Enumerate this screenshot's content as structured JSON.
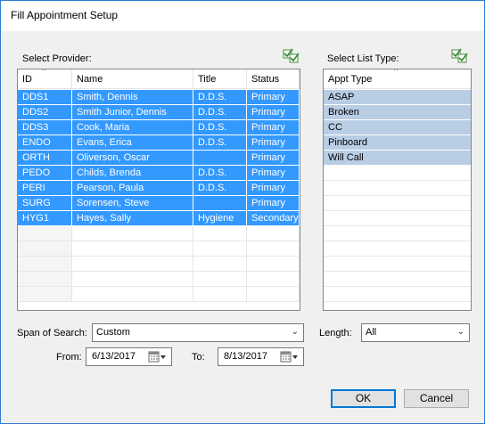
{
  "window": {
    "title": "Fill Appointment Setup"
  },
  "provider": {
    "label": "Select Provider:",
    "check_icon": "select-all-check-icon",
    "columns": [
      "ID",
      "Name",
      "Title",
      "Status"
    ],
    "sorted_column": "ID",
    "rows": [
      {
        "id": "DDS1",
        "name": "Smith, Dennis",
        "title": "D.D.S.",
        "status": "Primary",
        "selected": true
      },
      {
        "id": "DDS2",
        "name": "Smith Junior, Dennis",
        "title": "D.D.S.",
        "status": "Primary",
        "selected": true
      },
      {
        "id": "DDS3",
        "name": "Cook, Maria",
        "title": "D.D.S.",
        "status": "Primary",
        "selected": true
      },
      {
        "id": "ENDO",
        "name": "Evans, Erica",
        "title": "D.D.S.",
        "status": "Primary",
        "selected": true
      },
      {
        "id": "ORTH",
        "name": "Oliverson, Oscar",
        "title": "",
        "status": "Primary",
        "selected": true
      },
      {
        "id": "PEDO",
        "name": "Childs, Brenda",
        "title": "D.D.S.",
        "status": "Primary",
        "selected": true
      },
      {
        "id": "PERI",
        "name": "Pearson, Paula",
        "title": "D.D.S.",
        "status": "Primary",
        "selected": true
      },
      {
        "id": "SURG",
        "name": "Sorensen, Steve",
        "title": "",
        "status": "Primary",
        "selected": true
      },
      {
        "id": "HYG1",
        "name": "Hayes, Sally",
        "title": "Hygiene",
        "status": "Secondary",
        "selected": true
      }
    ]
  },
  "list_type": {
    "label": "Select List Type:",
    "check_icon": "select-all-check-icon",
    "columns": [
      "Appt Type"
    ],
    "rows": [
      "ASAP",
      "Broken",
      "CC",
      "Pinboard",
      "Will Call"
    ]
  },
  "search": {
    "span_label": "Span of Search:",
    "span_value": "Custom",
    "length_label": "Length:",
    "length_value": "All",
    "from_label": "From:",
    "from_value": "6/13/2017",
    "to_label": "To:",
    "to_value": "8/13/2017"
  },
  "buttons": {
    "ok": "OK",
    "cancel": "Cancel"
  },
  "colors": {
    "selection": "#3399ff",
    "inactive_selection": "#b9cde5",
    "accent": "#0078d7"
  }
}
